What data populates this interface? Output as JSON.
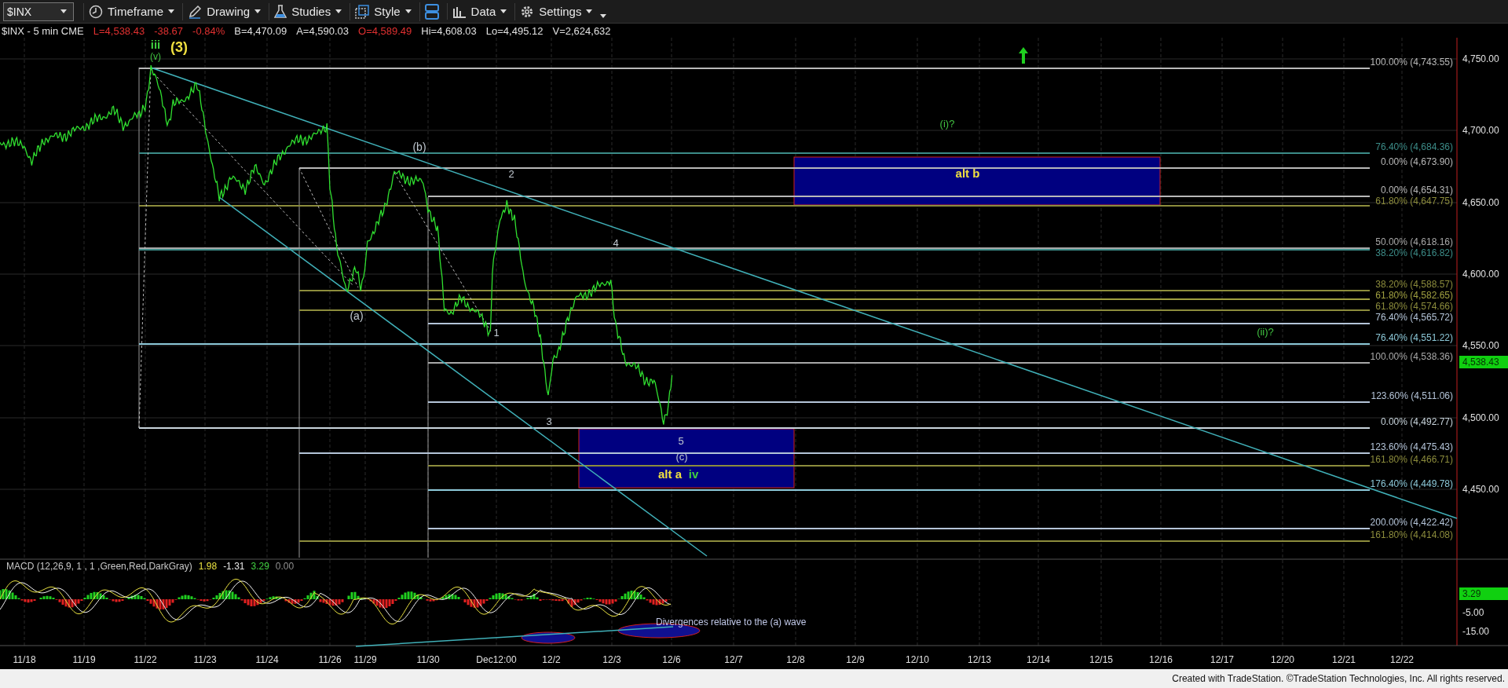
{
  "toolbar": {
    "symbol": "$INX",
    "buttons": [
      "Timeframe",
      "Drawing",
      "Studies",
      "Style",
      "Data",
      "Settings"
    ]
  },
  "quote": [
    {
      "text": "$INX - 5 min  CME",
      "color": "#e0e0e0"
    },
    {
      "text": "L=4,538.43",
      "color": "#e03030"
    },
    {
      "text": "-38.67",
      "color": "#e03030"
    },
    {
      "text": "-0.84%",
      "color": "#e03030"
    },
    {
      "text": "B=4,470.09",
      "color": "#e0e0e0"
    },
    {
      "text": "A=4,590.03",
      "color": "#e0e0e0"
    },
    {
      "text": "O=4,589.49",
      "color": "#e03030"
    },
    {
      "text": "Hi=4,608.03",
      "color": "#e0e0e0"
    },
    {
      "text": "Lo=4,495.12",
      "color": "#e0e0e0"
    },
    {
      "text": "V=2,624,632",
      "color": "#e0e0e0"
    }
  ],
  "price_axis": [
    "4,750.00",
    "4,700.00",
    "4,650.00",
    "4,600.00",
    "4,550.00",
    "4,500.00",
    "4,450.00"
  ],
  "last_price": "4,538.43",
  "fib_levels": [
    {
      "label": "100.00% (4,743.55)",
      "color": "#b8b8b8"
    },
    {
      "label": "76.40% (4,684.36)",
      "color": "#3c8c88"
    },
    {
      "label": "0.00% (4,673.90)",
      "color": "#b8b8b8"
    },
    {
      "label": "0.00% (4,654.31)",
      "color": "#b8b8b8"
    },
    {
      "label": "61.80% (4,647.75)",
      "color": "#8c8c3c"
    },
    {
      "label": "50.00% (4,618.16)",
      "color": "#a8a8a8"
    },
    {
      "label": "38.20% (4,616.82)",
      "color": "#3c8c88"
    },
    {
      "label": "38.20% (4,588.57)",
      "color": "#8c8c3c"
    },
    {
      "label": "61.80% (4,582.65)",
      "color": "#a0a040"
    },
    {
      "label": "61.80% (4,574.66)",
      "color": "#8c8c3c"
    },
    {
      "label": "76.40% (4,565.72)",
      "color": "#b4c4d8"
    },
    {
      "label": "76.40% (4,551.22)",
      "color": "#8cc8d8"
    },
    {
      "label": "100.00% (4,538.36)",
      "color": "#a8a8a8"
    },
    {
      "label": "123.60% (4,511.06)",
      "color": "#b4c4d8"
    },
    {
      "label": "0.00% (4,492.77)",
      "color": "#c8d4dc"
    },
    {
      "label": "123.60% (4,475.43)",
      "color": "#b4c4d8"
    },
    {
      "label": "161.80% (4,466.71)",
      "color": "#8c8c3c"
    },
    {
      "label": "176.40% (4,449.78)",
      "color": "#8cc8d8"
    },
    {
      "label": "200.00% (4,422.42)",
      "color": "#b4c4d8"
    },
    {
      "label": "161.80% (4,414.08)",
      "color": "#8c8c3c"
    }
  ],
  "wave_labels": [
    {
      "text": "iii",
      "color": "#40d040"
    },
    {
      "text": "(v)",
      "color": "#40c040"
    },
    {
      "text": "(3)",
      "color": "#f0e040"
    },
    {
      "text": "(b)",
      "color": "#c0c8d0"
    },
    {
      "text": "(a)",
      "color": "#c0c8d0"
    },
    {
      "text": "2",
      "color": "#c0c8d0"
    },
    {
      "text": "1",
      "color": "#c0c8d0"
    },
    {
      "text": "3",
      "color": "#c0c8d0"
    },
    {
      "text": "4",
      "color": "#c0c8d0"
    },
    {
      "text": "5",
      "color": "#c0c8d0"
    },
    {
      "text": "(c)",
      "color": "#c0c8d0"
    },
    {
      "text": "alt a",
      "color": "#f0e040"
    },
    {
      "text": "iv",
      "color": "#40d040"
    },
    {
      "text": "alt b",
      "color": "#f0e040"
    },
    {
      "text": "(i)?",
      "color": "#40c040"
    },
    {
      "text": "(ii)?",
      "color": "#40c040"
    }
  ],
  "macd": {
    "legend": [
      {
        "text": "MACD (12,26,9, 1 , 1 ,Green,Red,DarkGray)",
        "color": "#c8c8c8"
      },
      {
        "text": "1.98",
        "color": "#e8e040"
      },
      {
        "text": "-1.31",
        "color": "#e8e8e8"
      },
      {
        "text": "3.29",
        "color": "#40d040"
      },
      {
        "text": "0.00",
        "color": "#909090"
      }
    ],
    "last_value": "3.29",
    "axis": [
      "-5.00",
      "-15.00"
    ],
    "note": "Divergences relative to the (a) wave"
  },
  "time_axis": [
    "11/18",
    "11/19",
    "11/22",
    "11/23",
    "11/24",
    "11/26",
    "11/29",
    "11/30",
    "Dec12:00",
    "12/2",
    "12/3",
    "12/6",
    "12/7",
    "12/8",
    "12/9",
    "12/10",
    "12/13",
    "12/14",
    "12/15",
    "12/16",
    "12/17",
    "12/20",
    "12/21",
    "12/22"
  ],
  "footer": "Created with TradeStation. ©TradeStation Technologies, Inc. All rights reserved."
}
